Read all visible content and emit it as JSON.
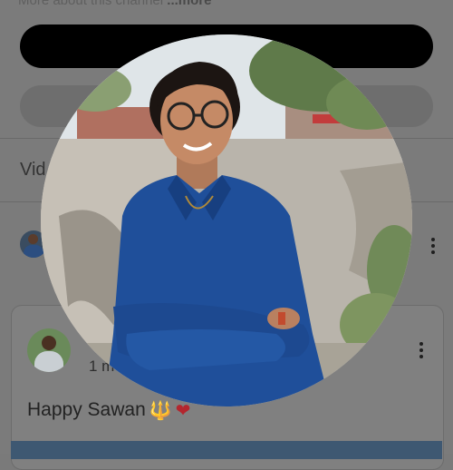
{
  "channel": {
    "more_about": "More about this channel",
    "more_link": "...more"
  },
  "tabs": {
    "videos": "Vid"
  },
  "post": {
    "time": "1 m",
    "text": "Happy Sawan",
    "emoji_trident": "🔱",
    "emoji_heart": "❤"
  },
  "colors": {
    "overlay": "#7b7b7b",
    "shirt": "#1f4f9a",
    "subscribe_bar": "#000000"
  }
}
